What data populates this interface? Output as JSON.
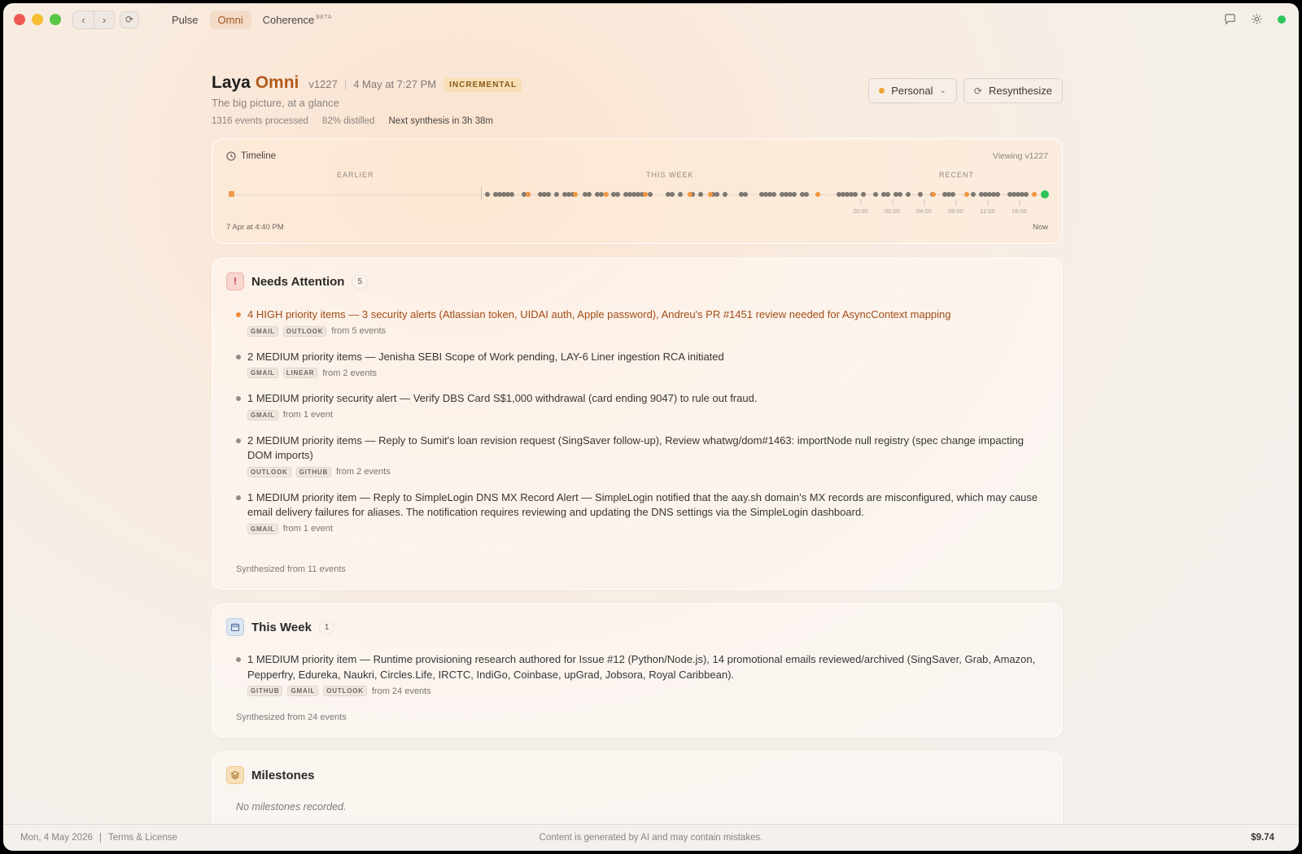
{
  "titlebar": {
    "tabs": [
      {
        "label": "Pulse",
        "active": false
      },
      {
        "label": "Omni",
        "active": true
      },
      {
        "label": "Coherence",
        "badge": "BETA",
        "active": false
      }
    ]
  },
  "header": {
    "title_name": "Laya",
    "title_accent": "Omni",
    "version": "v1227",
    "date": "4 May at 7:27 PM",
    "badge": "INCREMENTAL",
    "subtitle": "The big picture, at a glance",
    "stats": {
      "events": "1316 events processed",
      "distilled": "82% distilled",
      "next": "Next synthesis in 3h 38m"
    },
    "scope_label": "Personal",
    "resynth_label": "Resynthesize"
  },
  "timeline": {
    "title": "Timeline",
    "viewing": "Viewing v1227",
    "bands": [
      "EARLIER",
      "THIS WEEK",
      "RECENT"
    ],
    "hours": [
      "20:00",
      "00:00",
      "04:00",
      "08:00",
      "12:00",
      "16:00"
    ],
    "start_label": "7 Apr at 4:40 PM",
    "end_label": "Now"
  },
  "needs_attention": {
    "title": "Needs Attention",
    "count": "5",
    "items": [
      {
        "text": "4 HIGH priority items — 3 security alerts (Atlassian token, UIDAI auth, Apple password), Andreu's PR #1451 review needed for AsyncContext mapping",
        "sources": [
          "GMAIL",
          "OUTLOOK"
        ],
        "from": "from 5 events",
        "high": true
      },
      {
        "text": "2 MEDIUM priority items — Jenisha SEBI Scope of Work pending, LAY-6 Liner ingestion RCA initiated",
        "sources": [
          "GMAIL",
          "LINEAR"
        ],
        "from": "from 2 events",
        "high": false
      },
      {
        "text": "1 MEDIUM priority security alert — Verify DBS Card S$1,000 withdrawal (card ending 9047) to rule out fraud.",
        "sources": [
          "GMAIL"
        ],
        "from": "from 1 event",
        "high": false
      },
      {
        "text": "2 MEDIUM priority items — Reply to Sumit's loan revision request (SingSaver follow-up), Review whatwg/dom#1463: importNode null registry (spec change impacting DOM imports)",
        "sources": [
          "OUTLOOK",
          "GITHUB"
        ],
        "from": "from 2 events",
        "high": false
      },
      {
        "text": "1 MEDIUM priority item — Reply to SimpleLogin DNS MX Record Alert — SimpleLogin notified that the aay.sh domain's MX records are misconfigured, which may cause email delivery failures for aliases. The notification requires reviewing and updating the DNS settings via the SimpleLogin dashboard.",
        "sources": [
          "GMAIL"
        ],
        "from": "from 1 event",
        "high": false
      }
    ],
    "synth": "Synthesized from 11 events"
  },
  "this_week": {
    "title": "This Week",
    "count": "1",
    "items": [
      {
        "text": "1 MEDIUM priority item — Runtime provisioning research authored for Issue #12 (Python/Node.js), 14 promotional emails reviewed/archived (SingSaver, Grab, Amazon, Pepperfry, Edureka, Naukri, Circles.Life, IRCTC, IndiGo, Coinbase, upGrad, Jobsora, Royal Caribbean).",
        "sources": [
          "GITHUB",
          "GMAIL",
          "OUTLOOK"
        ],
        "from": "from 24 events",
        "high": false
      }
    ],
    "synth": "Synthesized from 24 events"
  },
  "milestones": {
    "title": "Milestones",
    "empty": "No milestones recorded."
  },
  "footer": {
    "date": "Mon, 4 May 2026",
    "sep": "|",
    "terms": "Terms & License",
    "disclaimer": "Content is generated by AI and may contain mistakes.",
    "cost": "$9.74"
  }
}
